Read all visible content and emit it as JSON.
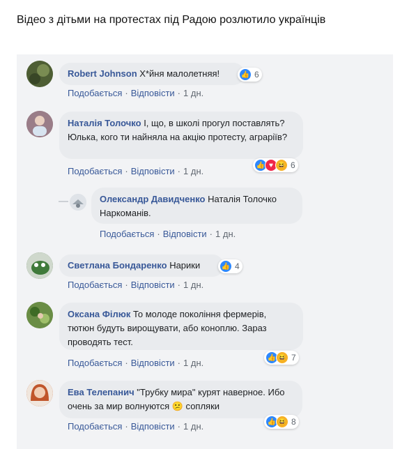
{
  "headline": "Відео з дітьми на протестах під Радою розлютило українців",
  "labels": {
    "like": "Подобається",
    "reply": "Відповісти",
    "sep": "·"
  },
  "comments": [
    {
      "author": "Robert Johnson",
      "text": "Х*йня малолетняя!",
      "time": "1 дн.",
      "reactions": [
        "like"
      ],
      "count": "6"
    },
    {
      "author": "Наталія Толочко",
      "text": "І, що, в школі прогул поставлять? Юлька, кого ти найняла на акцію протесту, аграріїв?",
      "time": "1 дн.",
      "reactions": [
        "like",
        "love",
        "haha"
      ],
      "count": "6"
    },
    {
      "author": "Олександр Давидченко",
      "text": "Наталія Толочко Наркоманів.",
      "time": "1 дн.",
      "reactions": [],
      "count": ""
    },
    {
      "author": "Светлана Бондаренко",
      "text": "Нарики",
      "time": "1 дн.",
      "reactions": [
        "like"
      ],
      "count": "4"
    },
    {
      "author": "Оксана Філюк",
      "text": "То молоде покоління фермерів, тютюн будуть вирощувати, або коноплю. Зараз проводять тест.",
      "time": "1 дн.",
      "reactions": [
        "like",
        "haha"
      ],
      "count": "7"
    },
    {
      "author": "Ева Телепанич",
      "text": "\"Трубку мира\" курят наверное. Ибо очень за мир волнуются 😕 сопляки",
      "time": "1 дн.",
      "reactions": [
        "like",
        "haha"
      ],
      "count": "8"
    }
  ]
}
